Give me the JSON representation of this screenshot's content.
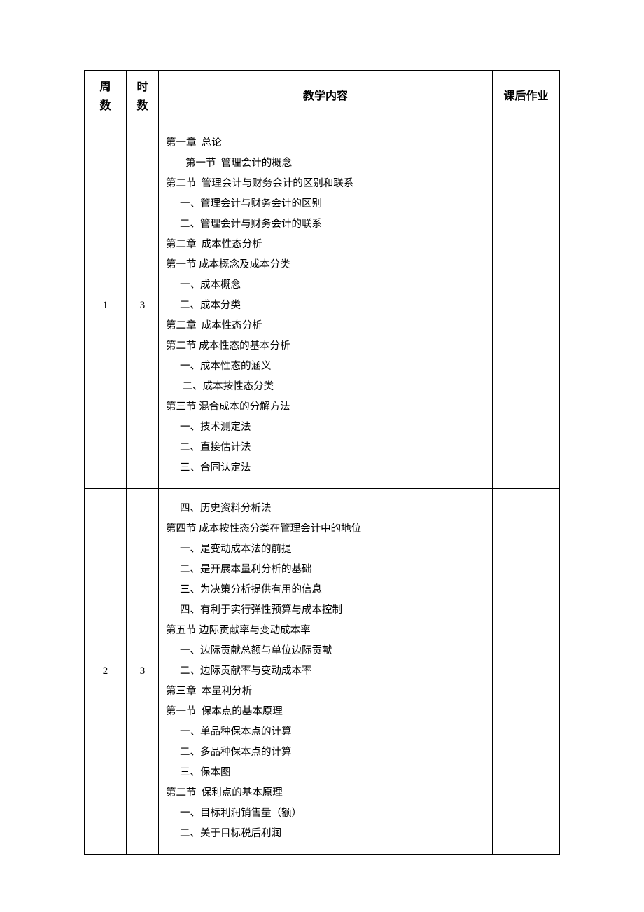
{
  "headers": {
    "week": "周数",
    "hours": "时数",
    "content": "教学内容",
    "homework": "课后作业"
  },
  "rows": [
    {
      "week": "1",
      "hours": "3",
      "homework": "",
      "content_lines": [
        {
          "indent": 0,
          "text": "第一章  总论"
        },
        {
          "indent": 1,
          "text": "第一节  管理会计的概念"
        },
        {
          "indent": 0,
          "text": "第二节  管理会计与财务会计的区别和联系"
        },
        {
          "indent": 2,
          "text": "一、管理会计与财务会计的区别"
        },
        {
          "indent": 2,
          "text": "二、管理会计与财务会计的联系"
        },
        {
          "indent": 0,
          "text": "第二章  成本性态分析"
        },
        {
          "indent": 0,
          "text": "第一节 成本概念及成本分类"
        },
        {
          "indent": 2,
          "text": "一、成本概念"
        },
        {
          "indent": 2,
          "text": "二、成本分类"
        },
        {
          "indent": 0,
          "text": "第二章  成本性态分析"
        },
        {
          "indent": 0,
          "text": "第二节 成本性态的基本分析"
        },
        {
          "indent": 2,
          "text": "一、成本性态的涵义"
        },
        {
          "indent": 2,
          "text": " 二、成本按性态分类"
        },
        {
          "indent": 0,
          "text": "第三节 混合成本的分解方法"
        },
        {
          "indent": 2,
          "text": "一、技术测定法"
        },
        {
          "indent": 2,
          "text": "二、直接估计法"
        },
        {
          "indent": 2,
          "text": "三、合同认定法"
        }
      ]
    },
    {
      "week": "2",
      "hours": "3",
      "homework": "",
      "content_lines": [
        {
          "indent": 2,
          "text": "四、历史资料分析法"
        },
        {
          "indent": 0,
          "text": "第四节 成本按性态分类在管理会计中的地位"
        },
        {
          "indent": 2,
          "text": "一、是变动成本法的前提"
        },
        {
          "indent": 2,
          "text": "二、是开展本量利分析的基础"
        },
        {
          "indent": 2,
          "text": "三、为决策分析提供有用的信息"
        },
        {
          "indent": 2,
          "text": "四、有利于实行弹性预算与成本控制"
        },
        {
          "indent": 0,
          "text": "第五节 边际贡献率与变动成本率"
        },
        {
          "indent": 2,
          "text": "一、边际贡献总额与单位边际贡献"
        },
        {
          "indent": 2,
          "text": "二、边际贡献率与变动成本率"
        },
        {
          "indent": 0,
          "text": "第三章  本量利分析"
        },
        {
          "indent": 0,
          "text": "第一节  保本点的基本原理"
        },
        {
          "indent": 2,
          "text": "一、单品种保本点的计算"
        },
        {
          "indent": 2,
          "text": "二、多品种保本点的计算"
        },
        {
          "indent": 2,
          "text": "三、保本图"
        },
        {
          "indent": 0,
          "text": "第二节  保利点的基本原理"
        },
        {
          "indent": 2,
          "text": "一、目标利润销售量（额）"
        },
        {
          "indent": 2,
          "text": "二、关于目标税后利润"
        }
      ]
    }
  ]
}
